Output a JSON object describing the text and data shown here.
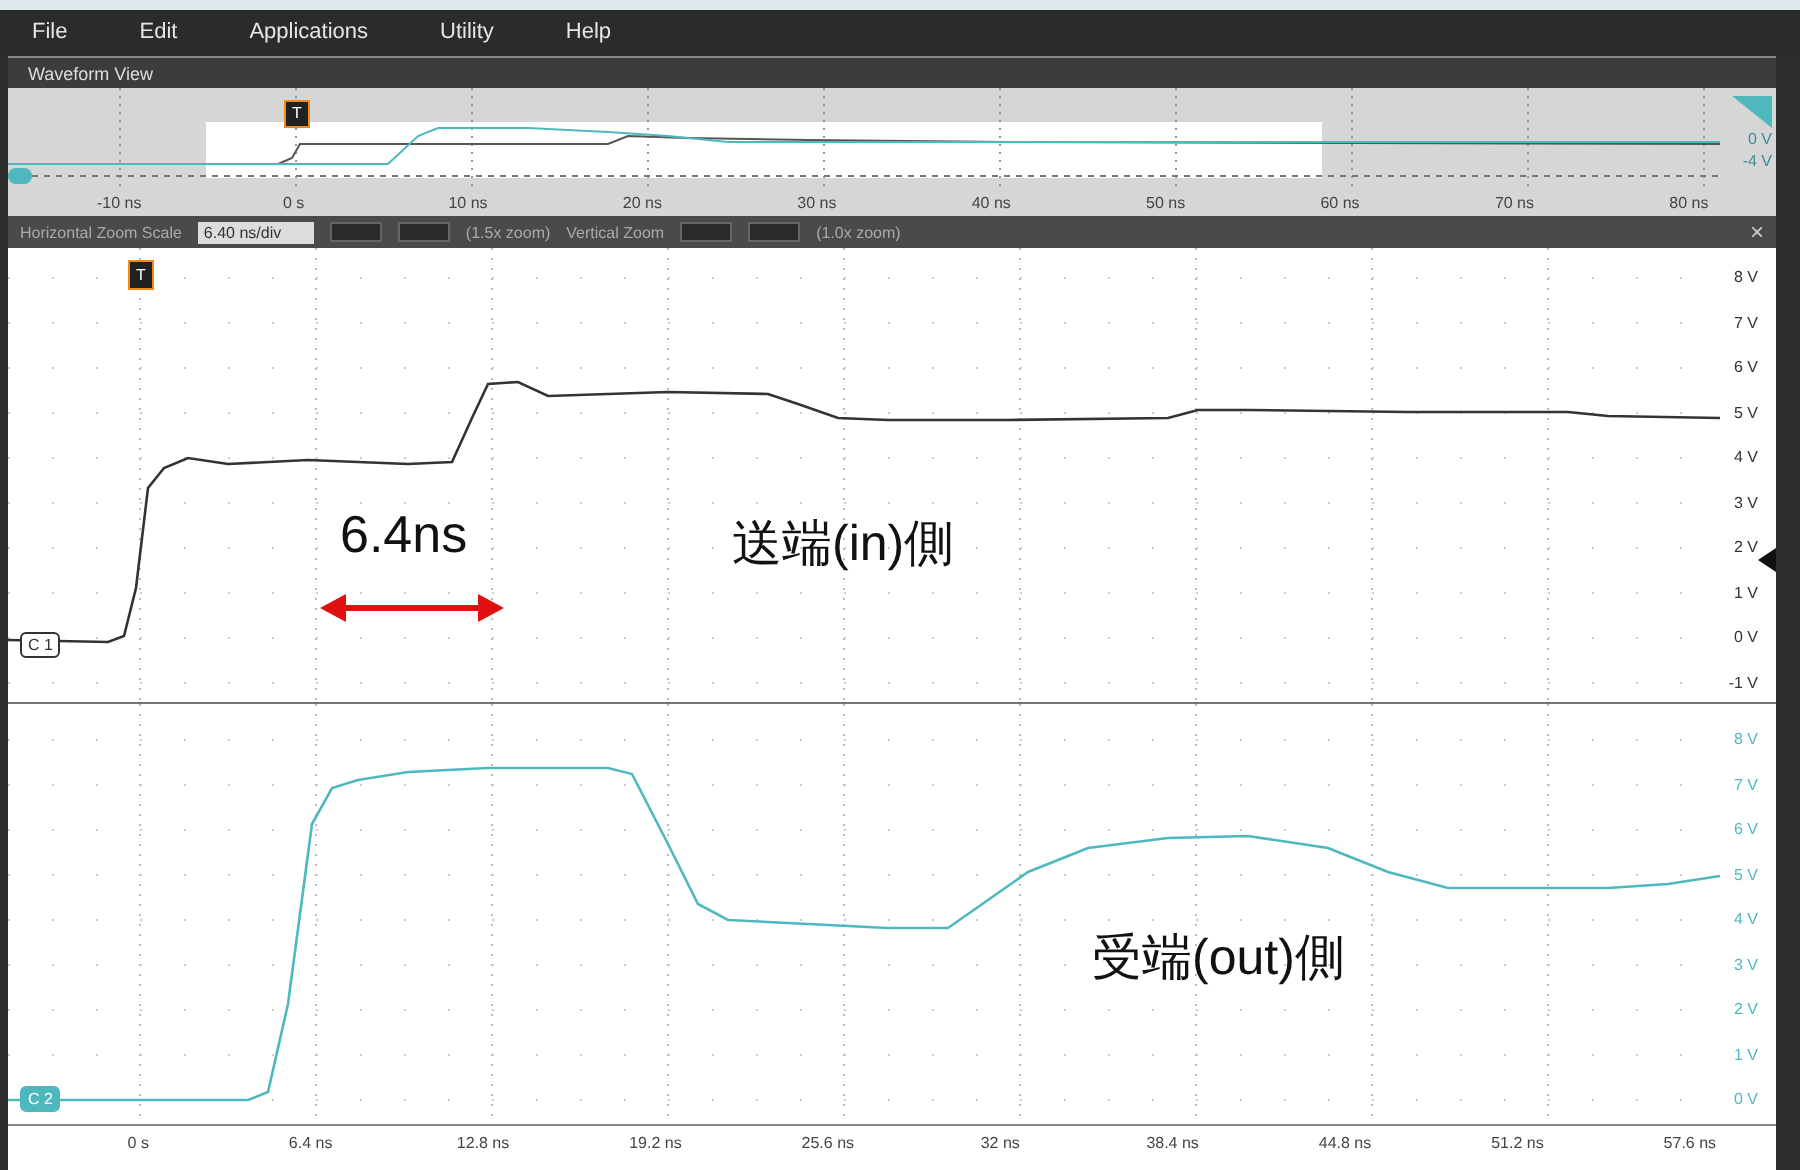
{
  "menu": [
    {
      "label": "File"
    },
    {
      "label": "Edit"
    },
    {
      "label": "Applications"
    },
    {
      "label": "Utility"
    },
    {
      "label": "Help"
    }
  ],
  "panel_title": "Waveform View",
  "overview": {
    "trigger": "T",
    "x_labels": [
      "-10 ns",
      "0 s",
      "10 ns",
      "20 ns",
      "30 ns",
      "40 ns",
      "50 ns",
      "60 ns",
      "70 ns",
      "80 ns"
    ],
    "y_labels": [
      "0 V",
      "-4 V"
    ]
  },
  "zoom_bar": {
    "horizontal_label": "Horizontal Zoom Scale",
    "horizontal_value": "6.40 ns/div",
    "horizontal_zoom": "(1.5x zoom)",
    "vertical_label": "Vertical Zoom",
    "vertical_zoom": "(1.0x zoom)",
    "close": "×"
  },
  "trigger": "T",
  "channels": [
    {
      "tag": "C 1",
      "color": "#333333",
      "annotation": "送端(in)側",
      "y_labels": [
        "8 V",
        "7 V",
        "6 V",
        "5 V",
        "4 V",
        "3 V",
        "2 V",
        "1 V",
        "0 V",
        "-1 V"
      ]
    },
    {
      "tag": "C 2",
      "color": "#4fb8bf",
      "annotation": "受端(out)側",
      "y_labels": [
        "8 V",
        "7 V",
        "6 V",
        "5 V",
        "4 V",
        "3 V",
        "2 V",
        "1 V",
        "0 V"
      ]
    }
  ],
  "measurement": "6.4ns",
  "x_labels": [
    "0 s",
    "6.4 ns",
    "12.8 ns",
    "19.2 ns",
    "25.6 ns",
    "32 ns",
    "38.4 ns",
    "44.8 ns",
    "51.2 ns",
    "57.6 ns"
  ]
}
